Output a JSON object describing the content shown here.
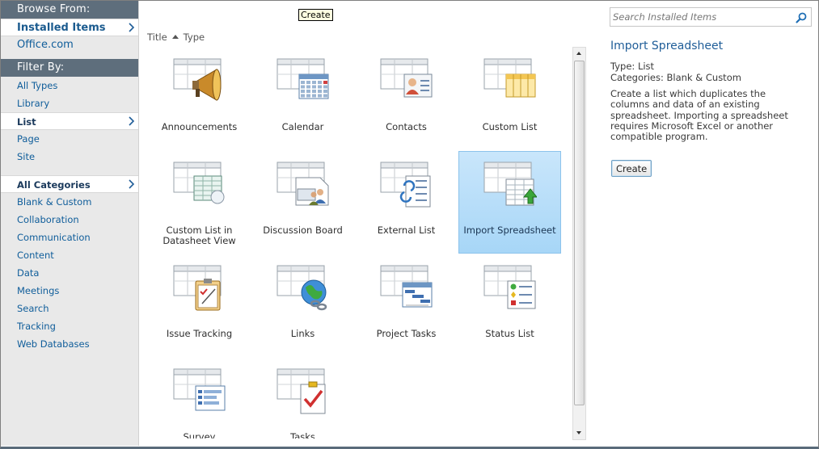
{
  "tooltip": "Create",
  "left_nav": {
    "browse_header": "Browse From:",
    "browse_items": [
      {
        "label": "Installed Items",
        "selected": true
      },
      {
        "label": "Office.com",
        "selected": false
      }
    ],
    "filter_header": "Filter By:",
    "type_items": [
      {
        "label": "All Types",
        "selected": false
      },
      {
        "label": "Library",
        "selected": false
      },
      {
        "label": "List",
        "selected": true
      },
      {
        "label": "Page",
        "selected": false
      },
      {
        "label": "Site",
        "selected": false
      }
    ],
    "category_items": [
      {
        "label": "All Categories",
        "selected": true
      },
      {
        "label": "Blank & Custom",
        "selected": false
      },
      {
        "label": "Collaboration",
        "selected": false
      },
      {
        "label": "Communication",
        "selected": false
      },
      {
        "label": "Content",
        "selected": false
      },
      {
        "label": "Data",
        "selected": false
      },
      {
        "label": "Meetings",
        "selected": false
      },
      {
        "label": "Search",
        "selected": false
      },
      {
        "label": "Tracking",
        "selected": false
      },
      {
        "label": "Web Databases",
        "selected": false
      }
    ]
  },
  "sort": {
    "title": "Title",
    "type": "Type"
  },
  "tiles": [
    {
      "label": "Announcements",
      "icon": "megaphone-icon",
      "selected": false
    },
    {
      "label": "Calendar",
      "icon": "calendar-icon",
      "selected": false
    },
    {
      "label": "Contacts",
      "icon": "contact-card-icon",
      "selected": false
    },
    {
      "label": "Custom List",
      "icon": "custom-list-icon",
      "selected": false
    },
    {
      "label": "Custom List in\nDatasheet View",
      "icon": "datasheet-icon",
      "selected": false
    },
    {
      "label": "Discussion Board",
      "icon": "discussion-icon",
      "selected": false
    },
    {
      "label": "External List",
      "icon": "external-list-icon",
      "selected": false
    },
    {
      "label": "Import Spreadsheet",
      "icon": "import-spreadsheet-icon",
      "selected": true
    },
    {
      "label": "Issue Tracking",
      "icon": "clipboard-check-icon",
      "selected": false
    },
    {
      "label": "Links",
      "icon": "globe-link-icon",
      "selected": false
    },
    {
      "label": "Project Tasks",
      "icon": "gantt-icon",
      "selected": false
    },
    {
      "label": "Status List",
      "icon": "status-indicators-icon",
      "selected": false
    },
    {
      "label": "Survey",
      "icon": "survey-icon",
      "selected": false
    },
    {
      "label": "Tasks",
      "icon": "task-check-icon",
      "selected": false
    }
  ],
  "search": {
    "placeholder": "Search Installed Items"
  },
  "detail": {
    "title": "Import Spreadsheet",
    "type_line": "Type: List",
    "categories_line": "Categories: Blank & Custom",
    "description": "Create a list which duplicates the columns and data of an existing spreadsheet.  Importing a spreadsheet requires Microsoft Excel or another compatible program.",
    "create_label": "Create"
  },
  "colors": {
    "accent": "#1f5d98",
    "nav_header": "#5e6e7c",
    "selected_tile": "#a7d6f7"
  }
}
